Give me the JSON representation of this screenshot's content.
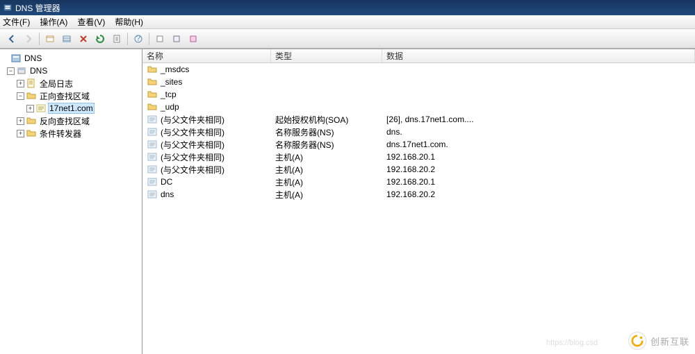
{
  "window_title": "DNS 管理器",
  "menu": {
    "file": "文件(F)",
    "action": "操作(A)",
    "view": "查看(V)",
    "help": "帮助(H)"
  },
  "columns": {
    "name": "名称",
    "type": "类型",
    "data": "数据"
  },
  "tree": {
    "root": "DNS",
    "server": "DNS",
    "global_log": "全局日志",
    "fwd_zone": "正向查找区域",
    "zone": "17net1.com",
    "rev_zone": "反向查找区域",
    "cond_fwd": "条件转发器"
  },
  "rows": [
    {
      "icon": "folder",
      "name": "_msdcs",
      "type": "",
      "data": ""
    },
    {
      "icon": "folder",
      "name": "_sites",
      "type": "",
      "data": ""
    },
    {
      "icon": "folder",
      "name": "_tcp",
      "type": "",
      "data": ""
    },
    {
      "icon": "folder",
      "name": "_udp",
      "type": "",
      "data": ""
    },
    {
      "icon": "record",
      "name": "(与父文件夹相同)",
      "type": "起始授权机构(SOA)",
      "data": "[26], dns.17net1.com...."
    },
    {
      "icon": "record",
      "name": "(与父文件夹相同)",
      "type": "名称服务器(NS)",
      "data": "dns."
    },
    {
      "icon": "record",
      "name": "(与父文件夹相同)",
      "type": "名称服务器(NS)",
      "data": "dns.17net1.com."
    },
    {
      "icon": "record",
      "name": "(与父文件夹相同)",
      "type": "主机(A)",
      "data": "192.168.20.1"
    },
    {
      "icon": "record",
      "name": "(与父文件夹相同)",
      "type": "主机(A)",
      "data": "192.168.20.2"
    },
    {
      "icon": "record",
      "name": "DC",
      "type": "主机(A)",
      "data": "192.168.20.1"
    },
    {
      "icon": "record",
      "name": "dns",
      "type": "主机(A)",
      "data": "192.168.20.2"
    }
  ],
  "watermark": {
    "text": "创新互联",
    "link": "https://blog.csd"
  }
}
